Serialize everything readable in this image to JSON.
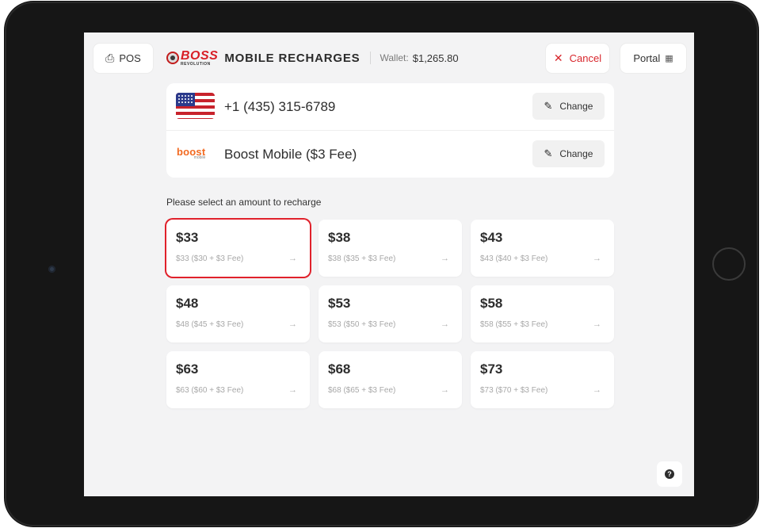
{
  "header": {
    "pos_label": "POS",
    "pos_icon": "cart-icon",
    "brand_logo": "BOSS",
    "brand_logo_sub": "REVOLUTION",
    "title": "MOBILE RECHARGES",
    "wallet_label": "Wallet:",
    "wallet_value": "$1,265.80",
    "cancel_label": "Cancel",
    "portal_label": "Portal",
    "portal_icon": "portal-icon"
  },
  "recipient": {
    "phone": "+1 (435) 315-6789",
    "carrier": "Boost Mobile ($3 Fee)",
    "carrier_logo": "boost",
    "carrier_logo_sub": "mobile",
    "change_label": "Change"
  },
  "prompt": "Please select an amount to recharge",
  "amounts": [
    {
      "label": "$33",
      "detail": "$33 ($30 + $3 Fee)",
      "selected": true
    },
    {
      "label": "$38",
      "detail": "$38 ($35 + $3 Fee)",
      "selected": false
    },
    {
      "label": "$43",
      "detail": "$43 ($40 + $3 Fee)",
      "selected": false
    },
    {
      "label": "$48",
      "detail": "$48 ($45 + $3 Fee)",
      "selected": false
    },
    {
      "label": "$53",
      "detail": "$53 ($50 + $3 Fee)",
      "selected": false
    },
    {
      "label": "$58",
      "detail": "$58 ($55 + $3 Fee)",
      "selected": false
    },
    {
      "label": "$63",
      "detail": "$63 ($60 + $3 Fee)",
      "selected": false
    },
    {
      "label": "$68",
      "detail": "$68 ($65 + $3 Fee)",
      "selected": false
    },
    {
      "label": "$73",
      "detail": "$73 ($70 + $3 Fee)",
      "selected": false
    }
  ],
  "colors": {
    "accent": "#e0212b",
    "brand_red": "#d81f26",
    "boost_orange": "#f26a21",
    "background": "#f3f3f4"
  }
}
